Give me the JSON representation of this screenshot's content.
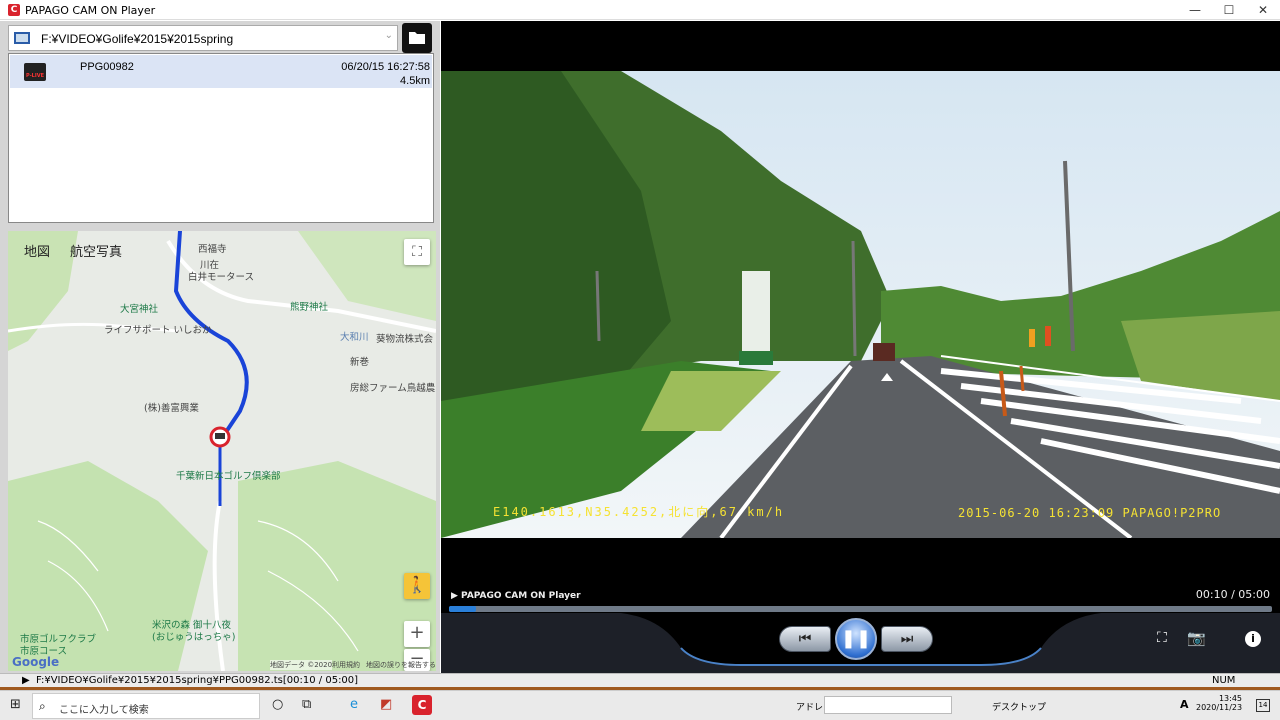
{
  "window": {
    "logo": "C",
    "title": "PAPAGO CAM ON Player",
    "minimize": "—",
    "maximize": "☐",
    "close": "✕"
  },
  "toolbar": {
    "path": "F:¥VIDEO¥Golife¥2015¥2015spring",
    "dropdown": "⌄"
  },
  "files": [
    {
      "name": "PPG00982",
      "date": "06/20/15 16:27:58",
      "distance": "4.5km",
      "icon_label": "P-LIVE"
    }
  ],
  "map": {
    "tabs": [
      "地図",
      "航空写真"
    ],
    "labels": [
      "西福寺",
      "川在",
      "白井モータース",
      "大宮神社",
      "熊野神社",
      "ライフサポート いしおか",
      "葵物流株式会",
      "大和川",
      "新巻",
      "房総ファーム鳥越農",
      "(株)善富興業",
      "千葉新日本ゴルフ倶楽部",
      "米沢の森 御十八夜",
      "(おじゅうはっちゃ)",
      "市原ゴルフクラブ",
      "市原コース"
    ],
    "zoom_in": "+",
    "zoom_out": "−",
    "google": "Google",
    "footer": [
      "地図データ ©2020",
      "利用規約",
      "地図の誤りを報告する"
    ]
  },
  "video": {
    "hud_left": "E140.1613,N35.4252,北に向,67 km/h",
    "hud_right": "2015-06-20 16:23:09 PAPAGO!P2PRO",
    "player_label": "▶ PAPAGO CAM ON Player",
    "time": "00:10 / 05:00",
    "progress": 0.033
  },
  "status": {
    "text": "F:¥VIDEO¥Golife¥2015¥2015spring¥PPG00982.ts[00:10 / 05:00]",
    "num": "NUM"
  },
  "taskbar": {
    "search_placeholder": "ここに入力して検索",
    "address": "アドレス",
    "desktop": "デスクトップ",
    "time": "13:45",
    "date": "2020/11/23",
    "notifications": "14",
    "ime": "A"
  },
  "colors": {
    "brand": "#d9232d",
    "route": "#1a44d8",
    "accent": "#2a7fd9",
    "hud": "#f5e233"
  }
}
